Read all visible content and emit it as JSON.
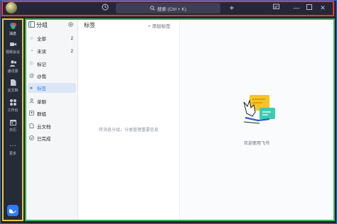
{
  "titlebar": {
    "search_placeholder": "搜索 (Ctrl + K)"
  },
  "rail": {
    "items": [
      {
        "label": "消息",
        "icon": "chat-bubbles-icon"
      },
      {
        "label": "视频会议",
        "icon": "video-camera-icon"
      },
      {
        "label": "通讯录",
        "icon": "contacts-icon"
      },
      {
        "label": "云文档",
        "icon": "cloud-doc-icon"
      },
      {
        "label": "工作台",
        "icon": "workbench-icon"
      },
      {
        "label": "日历",
        "icon": "calendar-icon"
      },
      {
        "label": "更多",
        "icon": "more-dots-icon"
      }
    ]
  },
  "groups": {
    "title": "分组",
    "items": [
      {
        "label": "全部",
        "count": "2",
        "icon": "chat-icon"
      },
      {
        "label": "未读",
        "count": "2",
        "icon": "unread-icon"
      },
      {
        "label": "标记",
        "count": "",
        "icon": "flag-icon"
      },
      {
        "label": "@我",
        "count": "",
        "icon": "at-icon"
      },
      {
        "label": "标签",
        "count": "",
        "icon": "tag-icon"
      },
      {
        "label": "单聊",
        "count": "",
        "icon": "person-icon"
      },
      {
        "label": "群组",
        "count": "",
        "icon": "group-icon"
      },
      {
        "label": "云文档",
        "count": "",
        "icon": "doc-icon"
      },
      {
        "label": "已完成",
        "count": "",
        "icon": "check-icon"
      }
    ]
  },
  "labels_panel": {
    "title": "标签",
    "add_label": "添加标签",
    "empty_hint": "将消息分组，分类管理重要信息"
  },
  "welcome": {
    "text": "欢迎使用飞书"
  },
  "colors": {
    "accent": "#2f7cf6",
    "selected_bg": "#dde6f7",
    "rail_bg": "#262b38"
  }
}
